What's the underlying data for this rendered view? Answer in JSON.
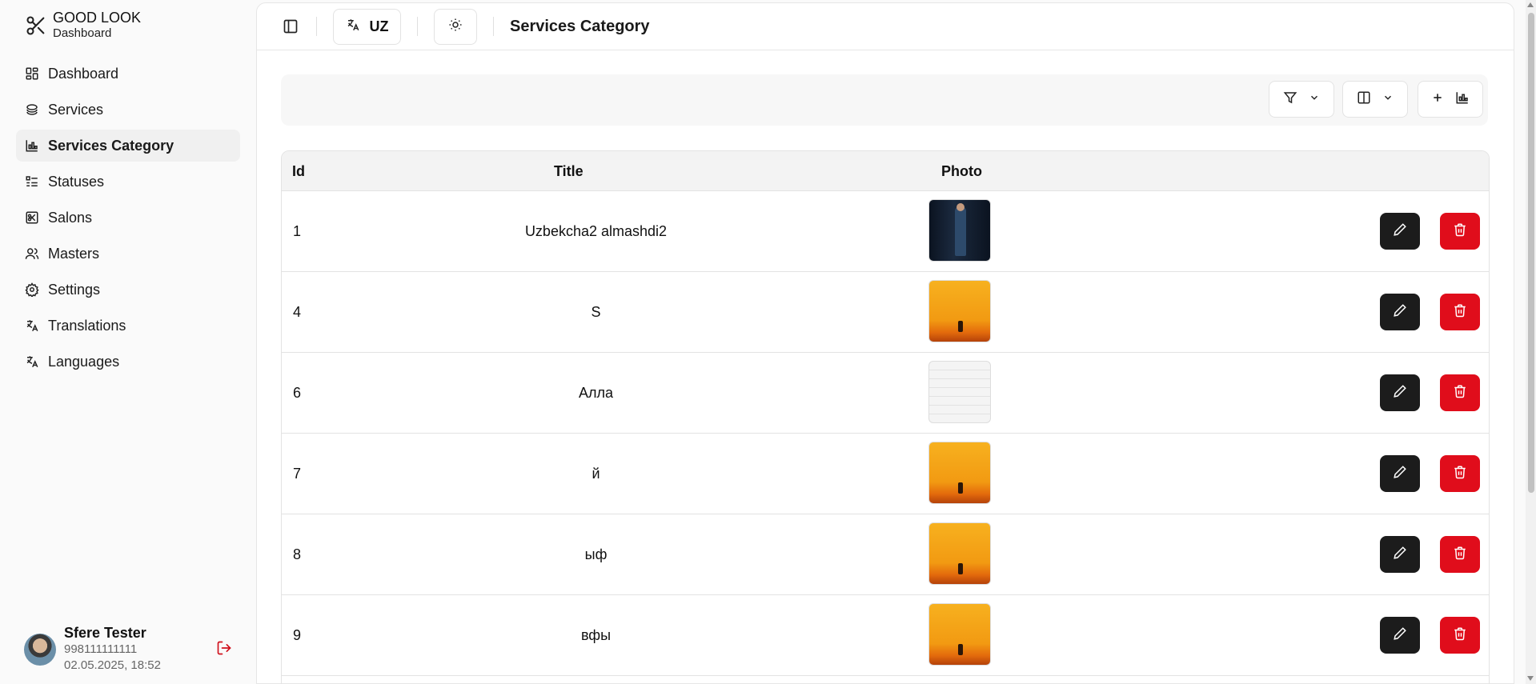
{
  "brand": {
    "name": "GOOD LOOK",
    "subtitle": "Dashboard",
    "icon": "scissors-icon"
  },
  "sidebar": {
    "items": [
      {
        "label": "Dashboard",
        "icon": "dashboard-icon",
        "active": false
      },
      {
        "label": "Services",
        "icon": "services-icon",
        "active": false
      },
      {
        "label": "Services Category",
        "icon": "chart-icon",
        "active": true
      },
      {
        "label": "Statuses",
        "icon": "list-icon",
        "active": false
      },
      {
        "label": "Salons",
        "icon": "salon-icon",
        "active": false
      },
      {
        "label": "Masters",
        "icon": "users-icon",
        "active": false
      },
      {
        "label": "Settings",
        "icon": "gear-icon",
        "active": false
      },
      {
        "label": "Translations",
        "icon": "translate-icon",
        "active": false
      },
      {
        "label": "Languages",
        "icon": "translate-icon",
        "active": false
      }
    ]
  },
  "user": {
    "name": "Sfere Tester",
    "phone": "998111111111",
    "date": "02.05.2025, 18:52"
  },
  "header": {
    "language": "UZ",
    "title": "Services Category"
  },
  "table": {
    "columns": [
      "Id",
      "Title",
      "Photo"
    ],
    "rows": [
      {
        "id": "1",
        "title": "Uzbekcha2 almashdi2",
        "photo": "suit"
      },
      {
        "id": "4",
        "title": "S",
        "photo": "sunset"
      },
      {
        "id": "6",
        "title": "Алла",
        "photo": "collage"
      },
      {
        "id": "7",
        "title": "й",
        "photo": "sunset"
      },
      {
        "id": "8",
        "title": "ыф",
        "photo": "sunset"
      },
      {
        "id": "9",
        "title": "вфы",
        "photo": "sunset"
      }
    ]
  },
  "colors": {
    "accent_danger": "#e00d1b",
    "accent_dark": "#1c1c1c"
  }
}
